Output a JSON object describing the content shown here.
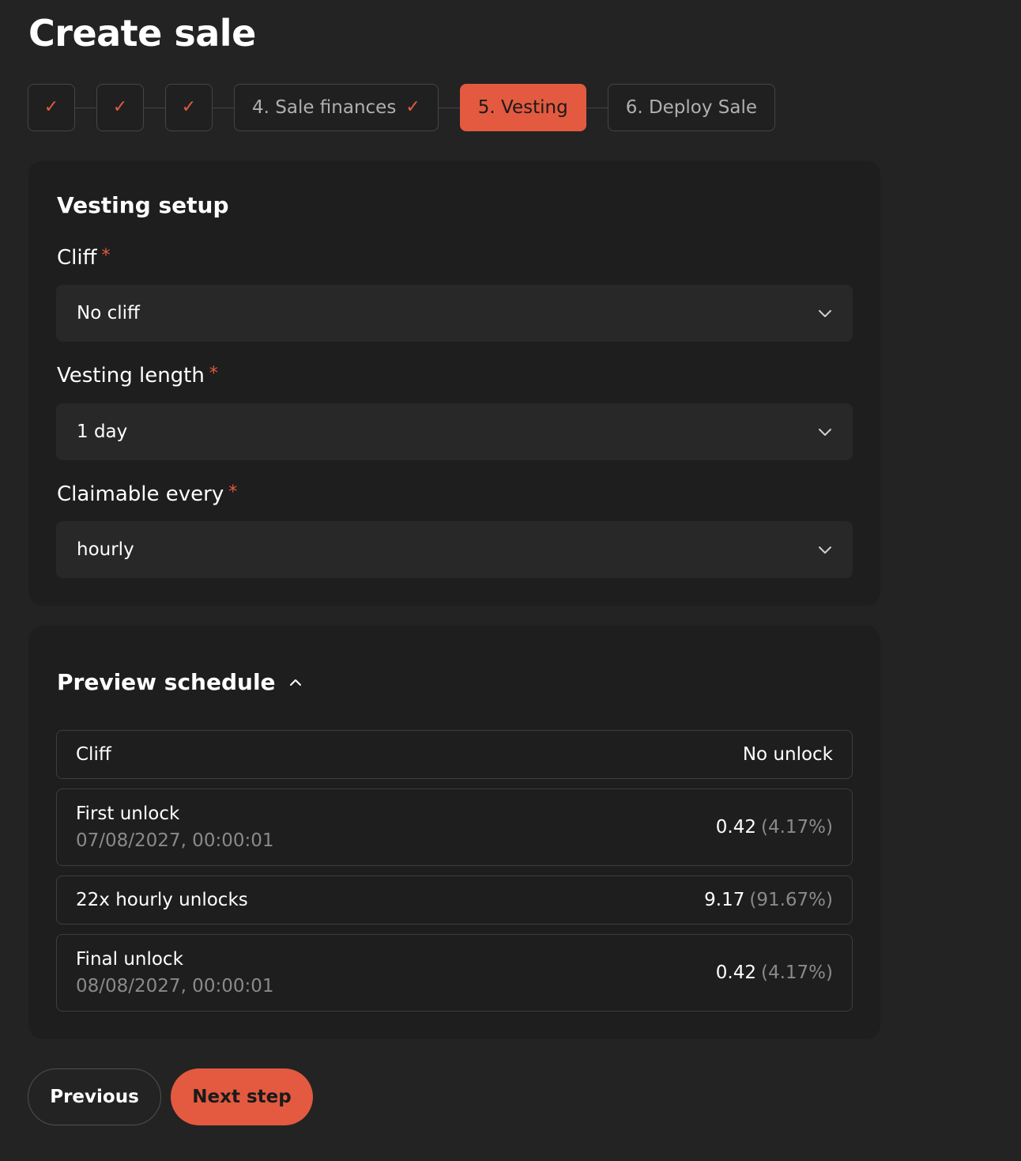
{
  "page": {
    "title": "Create sale"
  },
  "stepper": {
    "steps": [
      {
        "label": "",
        "state": "done"
      },
      {
        "label": "",
        "state": "done"
      },
      {
        "label": "",
        "state": "done"
      },
      {
        "label": "4. Sale finances",
        "state": "done"
      },
      {
        "label": "5. Vesting",
        "state": "active"
      },
      {
        "label": "6. Deploy Sale",
        "state": "upcoming"
      }
    ],
    "check_glyph": "✓"
  },
  "setup": {
    "title": "Vesting setup",
    "required_mark": "*",
    "cliff": {
      "label": "Cliff",
      "value": "No cliff"
    },
    "vesting_length": {
      "label": "Vesting length",
      "value": "1 day"
    },
    "claimable_every": {
      "label": "Claimable every",
      "value": "hourly"
    }
  },
  "preview": {
    "title": "Preview schedule",
    "rows": [
      {
        "label": "Cliff",
        "date": "",
        "amount": "No unlock",
        "percent": ""
      },
      {
        "label": "First unlock",
        "date": "07/08/2027, 00:00:01",
        "amount": "0.42",
        "percent": "(4.17%)"
      },
      {
        "label": "22x hourly unlocks",
        "date": "",
        "amount": "9.17",
        "percent": "(91.67%)"
      },
      {
        "label": "Final unlock",
        "date": "08/08/2027, 00:00:01",
        "amount": "0.42",
        "percent": "(4.17%)"
      }
    ]
  },
  "actions": {
    "previous_label": "Previous",
    "next_label": "Next step"
  },
  "colors": {
    "accent": "#e35a40",
    "background": "#232323",
    "card": "#1e1e1e"
  }
}
